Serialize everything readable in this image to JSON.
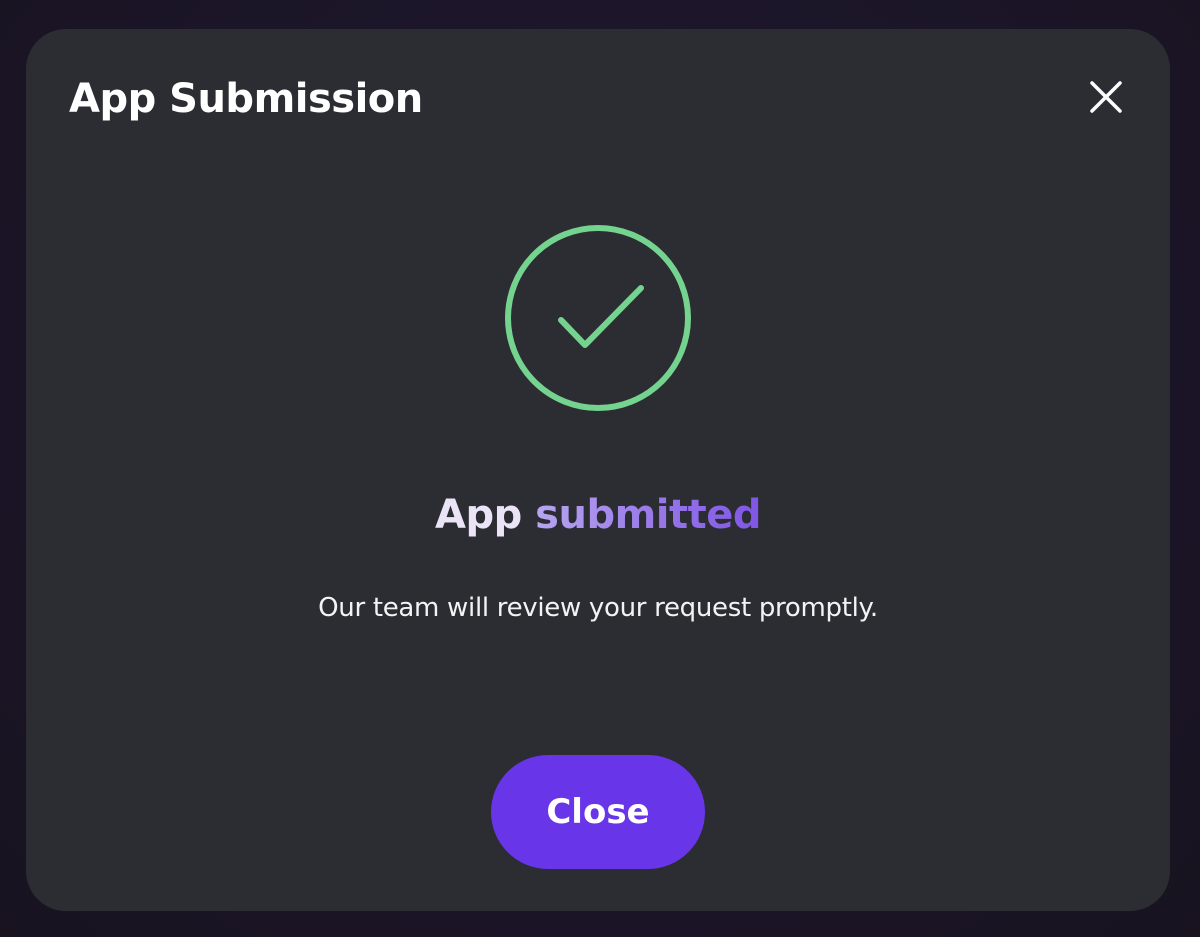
{
  "modal": {
    "title": "App Submission",
    "close_icon": "close-icon"
  },
  "status": {
    "icon": "check-circle-icon",
    "icon_color": "#74d38e",
    "heading_part1": "App",
    "heading_part2": "submitted",
    "message": "Our team will review your request promptly."
  },
  "actions": {
    "close_label": "Close",
    "close_color": "#6836e8"
  }
}
